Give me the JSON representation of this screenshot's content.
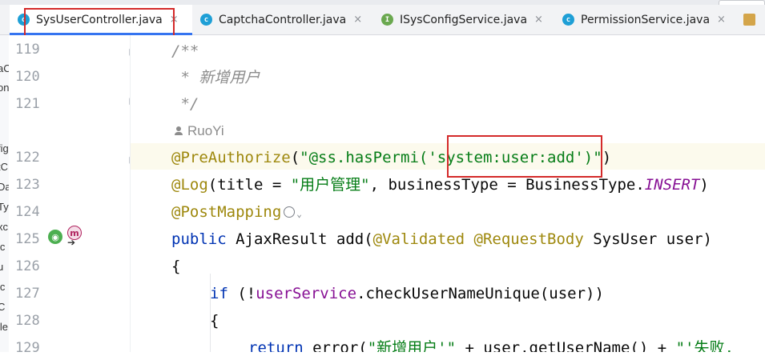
{
  "tabs": [
    {
      "label": "SysUserController.java",
      "icon": "class-icon",
      "active": true
    },
    {
      "label": "CaptchaController.java",
      "icon": "class-icon",
      "active": false
    },
    {
      "label": "ISysConfigService.java",
      "icon": "interface-icon",
      "active": false
    },
    {
      "label": "PermissionService.java",
      "icon": "class-icon",
      "active": false
    }
  ],
  "close_glyph": "×",
  "line_numbers": [
    "119",
    "120",
    "121",
    "122",
    "123",
    "124",
    "125",
    "126",
    "127",
    "128",
    "129"
  ],
  "code": {
    "l119": "/**",
    "l120": " * 新增用户",
    "l121": " */",
    "author": "RuoYi",
    "l122_ann": "@PreAuthorize",
    "l122_str_a": "\"@ss.hasPermi('",
    "l122_str_b": "system:user:add",
    "l122_str_c": "')\"",
    "l123_ann": "@Log",
    "l123_rest_a": "(title = ",
    "l123_str": "\"用户管理\"",
    "l123_rest_b": ", businessType = BusinessType.",
    "l123_const": "INSERT",
    "l124_ann": "@PostMapping",
    "l125_kw": "public",
    "l125_a": " AjaxResult add(",
    "l125_ann1": "@Validated",
    "l125_ann2": "@RequestBody",
    "l125_b": " SysUser user)",
    "l126": "{",
    "l127_kw": "if",
    "l127_a": " (!",
    "l127_field": "userService",
    "l127_b": ".checkUserNameUnique(user))",
    "l128": "{",
    "l129_kw": "return",
    "l129_a": " error(",
    "l129_str1": "\"新增用户'\"",
    "l129_b": " + user.getUserName() + ",
    "l129_str2": "\"'失败,"
  },
  "left_panel_fragments": [
    "aC",
    "on",
    "fig",
    "tC",
    "Da",
    "Ty",
    "xc",
    "ic",
    "u",
    "ic",
    "C",
    "ile"
  ],
  "gutter_icons": [
    "web-endpoint-icon",
    "method-icon",
    "navigate-arrow-icon"
  ],
  "colors": {
    "annotation": "#9e880d",
    "string": "#067d17",
    "keyword": "#0033b3",
    "field": "#871094",
    "comment": "#8c8c8c",
    "highlight_box": "#d42a2a"
  }
}
